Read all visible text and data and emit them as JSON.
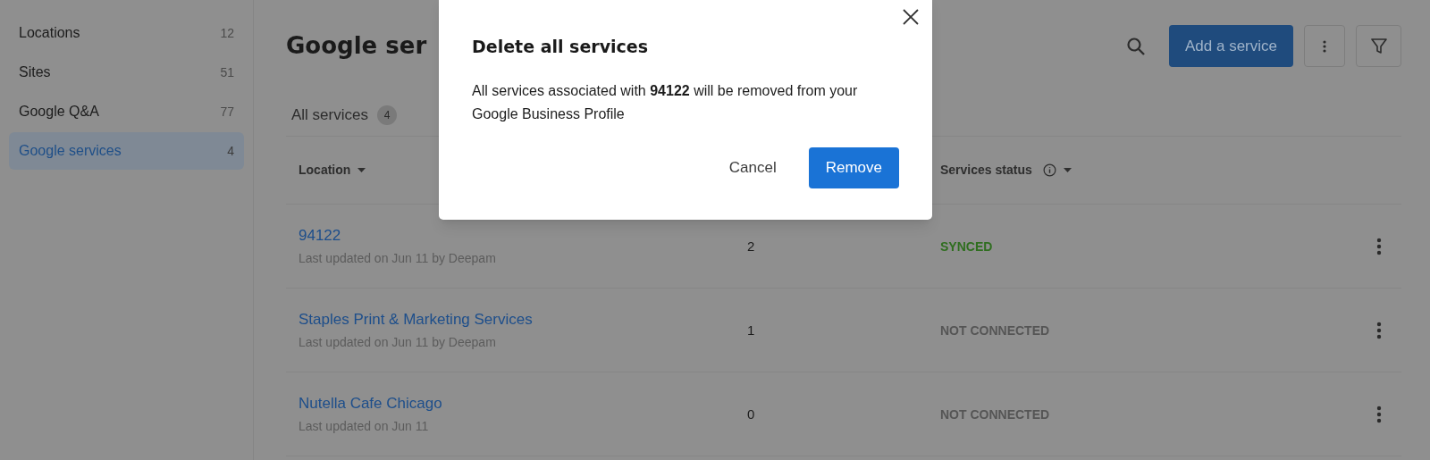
{
  "sidebar": {
    "items": [
      {
        "label": "Locations",
        "count": "12",
        "selected": false
      },
      {
        "label": "Sites",
        "count": "51",
        "selected": false
      },
      {
        "label": "Google Q&A",
        "count": "77",
        "selected": false
      },
      {
        "label": "Google services",
        "count": "4",
        "selected": true
      }
    ]
  },
  "page": {
    "title": "Google ser",
    "add_button": "Add a service"
  },
  "tabs": [
    {
      "label": "All services",
      "count": "4",
      "selected": true
    }
  ],
  "table": {
    "columns": [
      {
        "label": "Location",
        "sortable": true,
        "info": false
      },
      {
        "label": "Services status",
        "sortable": true,
        "info": true
      }
    ],
    "rows": [
      {
        "name": "94122",
        "updated": "Last updated on Jun 11 by Deepam",
        "count": "2",
        "status": "SYNCED",
        "kind": "synced"
      },
      {
        "name": "Staples Print & Marketing Services",
        "updated": "Last updated on Jun 11 by Deepam",
        "count": "1",
        "status": "NOT CONNECTED",
        "kind": "not_connected"
      },
      {
        "name": "Nutella Cafe Chicago",
        "updated": "Last updated on Jun 11",
        "count": "0",
        "status": "NOT CONNECTED",
        "kind": "not_connected"
      }
    ]
  },
  "dialog": {
    "title": "Delete all services",
    "message": "All services associated with **94122** will be removed from your Google Business Profile",
    "buttons": [
      {
        "label": "Cancel",
        "kind": "text"
      },
      {
        "label": "Remove",
        "kind": "primary"
      }
    ]
  }
}
